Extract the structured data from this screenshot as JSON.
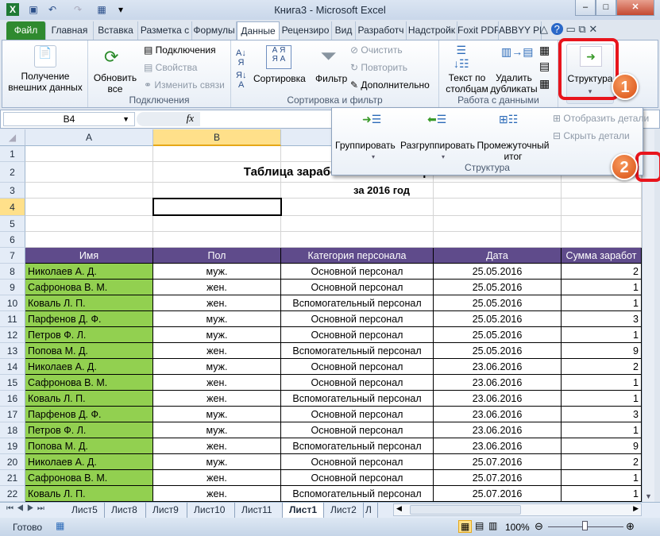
{
  "window": {
    "title": "Книга3  -  Microsoft Excel"
  },
  "tabs": [
    "Файл",
    "Главная",
    "Вставка",
    "Разметка с",
    "Формулы",
    "Данные",
    "Рецензиро",
    "Вид",
    "Разработч",
    "Надстройк",
    "Foxit PDF",
    "ABBYY PDF"
  ],
  "active_tab": "Данные",
  "ribbon": {
    "get_external": "Получение внешних данных",
    "refresh_all": "Обновить все",
    "connections": "Подключения",
    "properties": "Свойства",
    "edit_links": "Изменить связи",
    "group_connections": "Подключения",
    "sort": "Сортировка",
    "filter": "Фильтр",
    "clear": "Очистить",
    "reapply": "Повторить",
    "advanced": "Дополнительно",
    "group_sort": "Сортировка и фильтр",
    "text_to_columns": "Текст по столбцам",
    "remove_duplicates": "Удалить дубликаты",
    "group_data_tools": "Работа с данными",
    "outline": "Структура"
  },
  "outline_popup": {
    "group": "Группировать",
    "ungroup": "Разгруппировать",
    "subtotal": "Промежуточный итог",
    "show_detail": "Отобразить детали",
    "hide_detail": "Скрыть детали",
    "label": "Структура"
  },
  "annotations": {
    "badge1": "1",
    "badge2": "2",
    "highlight_color": "#e8141c"
  },
  "formula_bar": {
    "name_box": "B4",
    "fx": "fx",
    "value": ""
  },
  "columns": [
    "A",
    "B",
    "C",
    "D",
    "E"
  ],
  "selected_cell": "B4",
  "sheet": {
    "title": "Таблица заработной платы персонала",
    "subtitle": "за 2016 год",
    "headers": [
      "Имя",
      "Пол",
      "Категория персонала",
      "Дата",
      "Сумма заработ"
    ],
    "rows": [
      [
        "Николаев А. Д.",
        "муж.",
        "Основной персонал",
        "25.05.2016",
        "2"
      ],
      [
        "Сафронова В. М.",
        "жен.",
        "Основной персонал",
        "25.05.2016",
        "1"
      ],
      [
        "Коваль Л. П.",
        "жен.",
        "Вспомогательный персонал",
        "25.05.2016",
        "1"
      ],
      [
        "Парфенов Д. Ф.",
        "муж.",
        "Основной персонал",
        "25.05.2016",
        "3"
      ],
      [
        "Петров Ф. Л.",
        "муж.",
        "Основной персонал",
        "25.05.2016",
        "1"
      ],
      [
        "Попова М. Д.",
        "жен.",
        "Вспомогательный персонал",
        "25.05.2016",
        "9"
      ],
      [
        "Николаев А. Д.",
        "муж.",
        "Основной персонал",
        "23.06.2016",
        "2"
      ],
      [
        "Сафронова В. М.",
        "жен.",
        "Основной персонал",
        "23.06.2016",
        "1"
      ],
      [
        "Коваль Л. П.",
        "жен.",
        "Вспомогательный персонал",
        "23.06.2016",
        "1"
      ],
      [
        "Парфенов Д. Ф.",
        "муж.",
        "Основной персонал",
        "23.06.2016",
        "3"
      ],
      [
        "Петров Ф. Л.",
        "муж.",
        "Основной персонал",
        "23.06.2016",
        "1"
      ],
      [
        "Попова М. Д.",
        "жен.",
        "Вспомогательный персонал",
        "23.06.2016",
        "9"
      ],
      [
        "Николаев А. Д.",
        "муж.",
        "Основной персонал",
        "25.07.2016",
        "2"
      ],
      [
        "Сафронова В. М.",
        "жен.",
        "Основной персонал",
        "25.07.2016",
        "1"
      ],
      [
        "Коваль Л. П.",
        "жен.",
        "Вспомогательный персонал",
        "25.07.2016",
        "1"
      ]
    ],
    "name_color": "#92d050",
    "header_color": "#5f4b8b"
  },
  "sheet_tabs": [
    "Лист5",
    "Лист8",
    "Лист9",
    "Лист10",
    "Лист11",
    "Лист1",
    "Лист2",
    "Л"
  ],
  "active_sheet": "Лист1",
  "status": {
    "ready": "Готово",
    "zoom": "100%"
  }
}
